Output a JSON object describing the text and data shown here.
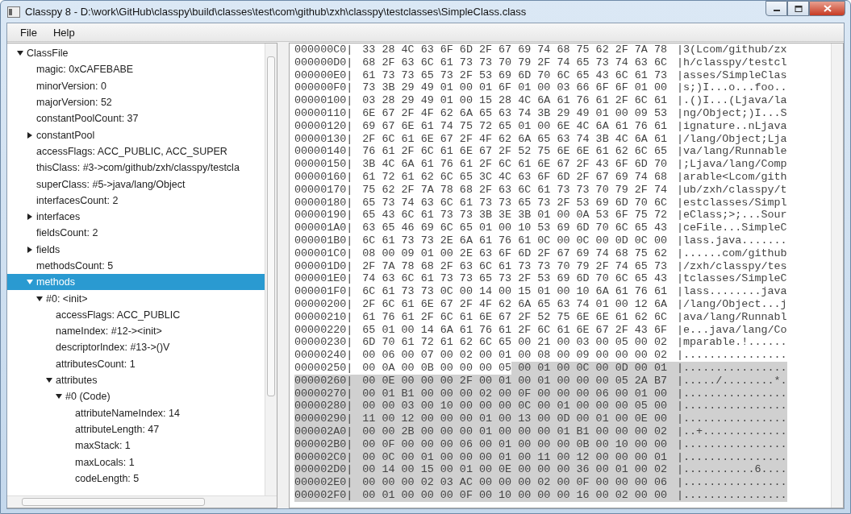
{
  "window": {
    "title": "Classpy 8 - D:\\work\\GitHub\\classpy\\build\\classes\\test\\com\\github\\zxh\\classpy\\testclasses\\SimpleClass.class"
  },
  "menu": [
    "File",
    "Help"
  ],
  "tree": [
    {
      "label": "ClassFile",
      "expanded": true,
      "selected": false,
      "children": [
        {
          "label": "magic: 0xCAFEBABE",
          "selected": false
        },
        {
          "label": "minorVersion: 0",
          "selected": false
        },
        {
          "label": "majorVersion: 52",
          "selected": false
        },
        {
          "label": "constantPoolCount: 37",
          "selected": false
        },
        {
          "label": "constantPool",
          "expanded": false,
          "selected": false
        },
        {
          "label": "accessFlags: ACC_PUBLIC, ACC_SUPER",
          "selected": false
        },
        {
          "label": "thisClass: #3->com/github/zxh/classpy/testcla",
          "selected": false
        },
        {
          "label": "superClass: #5->java/lang/Object",
          "selected": false
        },
        {
          "label": "interfacesCount: 2",
          "selected": false
        },
        {
          "label": "interfaces",
          "expanded": false,
          "selected": false
        },
        {
          "label": "fieldsCount: 2",
          "selected": false
        },
        {
          "label": "fields",
          "expanded": false,
          "selected": false
        },
        {
          "label": "methodsCount: 5",
          "selected": false
        },
        {
          "label": "methods",
          "expanded": true,
          "selected": true,
          "children": [
            {
              "label": "#0: <init>",
              "expanded": true,
              "selected": false,
              "children": [
                {
                  "label": "accessFlags: ACC_PUBLIC",
                  "selected": false
                },
                {
                  "label": "nameIndex: #12-><init>",
                  "selected": false
                },
                {
                  "label": "descriptorIndex: #13->()V",
                  "selected": false
                },
                {
                  "label": "attributesCount: 1",
                  "selected": false
                },
                {
                  "label": "attributes",
                  "expanded": true,
                  "selected": false,
                  "children": [
                    {
                      "label": "#0 (Code)",
                      "expanded": true,
                      "selected": false,
                      "children": [
                        {
                          "label": "attributeNameIndex: 14",
                          "selected": false
                        },
                        {
                          "label": "attributeLength: 47",
                          "selected": false
                        },
                        {
                          "label": "maxStack: 1",
                          "selected": false
                        },
                        {
                          "label": "maxLocals: 1",
                          "selected": false
                        },
                        {
                          "label": "codeLength: 5",
                          "selected": false
                        }
                      ]
                    }
                  ]
                }
              ]
            }
          ]
        }
      ]
    }
  ],
  "hex": [
    {
      "offset": "000000C0|",
      "bytes": "33 28 4C 63 6F 6D 2F 67 69 74 68 75 62 2F 7A 78",
      "ascii": "|3(Lcom/github/zx",
      "selected": false,
      "ascii_selected": false
    },
    {
      "offset": "000000D0|",
      "bytes": "68 2F 63 6C 61 73 73 70 79 2F 74 65 73 74 63 6C",
      "ascii": "|h/classpy/testcl",
      "selected": false,
      "ascii_selected": false
    },
    {
      "offset": "000000E0|",
      "bytes": "61 73 73 65 73 2F 53 69 6D 70 6C 65 43 6C 61 73",
      "ascii": "|asses/SimpleClas",
      "selected": false,
      "ascii_selected": false
    },
    {
      "offset": "000000F0|",
      "bytes": "73 3B 29 49 01 00 01 6F 01 00 03 66 6F 6F 01 00",
      "ascii": "|s;)I...o...foo..",
      "selected": false,
      "ascii_selected": false
    },
    {
      "offset": "00000100|",
      "bytes": "03 28 29 49 01 00 15 28 4C 6A 61 76 61 2F 6C 61",
      "ascii": "|.()I...(Ljava/la",
      "selected": false,
      "ascii_selected": false
    },
    {
      "offset": "00000110|",
      "bytes": "6E 67 2F 4F 62 6A 65 63 74 3B 29 49 01 00 09 53",
      "ascii": "|ng/Object;)I...S",
      "selected": false,
      "ascii_selected": false
    },
    {
      "offset": "00000120|",
      "bytes": "69 67 6E 61 74 75 72 65 01 00 6E 4C 6A 61 76 61",
      "ascii": "|ignature..nLjava",
      "selected": false,
      "ascii_selected": false
    },
    {
      "offset": "00000130|",
      "bytes": "2F 6C 61 6E 67 2F 4F 62 6A 65 63 74 3B 4C 6A 61",
      "ascii": "|/lang/Object;Lja",
      "selected": false,
      "ascii_selected": false
    },
    {
      "offset": "00000140|",
      "bytes": "76 61 2F 6C 61 6E 67 2F 52 75 6E 6E 61 62 6C 65",
      "ascii": "|va/lang/Runnable",
      "selected": false,
      "ascii_selected": false
    },
    {
      "offset": "00000150|",
      "bytes": "3B 4C 6A 61 76 61 2F 6C 61 6E 67 2F 43 6F 6D 70",
      "ascii": "|;Ljava/lang/Comp",
      "selected": false,
      "ascii_selected": false
    },
    {
      "offset": "00000160|",
      "bytes": "61 72 61 62 6C 65 3C 4C 63 6F 6D 2F 67 69 74 68",
      "ascii": "|arable<Lcom/gith",
      "selected": false,
      "ascii_selected": false
    },
    {
      "offset": "00000170|",
      "bytes": "75 62 2F 7A 78 68 2F 63 6C 61 73 73 70 79 2F 74",
      "ascii": "|ub/zxh/classpy/t",
      "selected": false,
      "ascii_selected": false
    },
    {
      "offset": "00000180|",
      "bytes": "65 73 74 63 6C 61 73 73 65 73 2F 53 69 6D 70 6C",
      "ascii": "|estclasses/Simpl",
      "selected": false,
      "ascii_selected": false
    },
    {
      "offset": "00000190|",
      "bytes": "65 43 6C 61 73 73 3B 3E 3B 01 00 0A 53 6F 75 72",
      "ascii": "|eClass;>;...Sour",
      "selected": false,
      "ascii_selected": false
    },
    {
      "offset": "000001A0|",
      "bytes": "63 65 46 69 6C 65 01 00 10 53 69 6D 70 6C 65 43",
      "ascii": "|ceFile...SimpleC",
      "selected": false,
      "ascii_selected": false
    },
    {
      "offset": "000001B0|",
      "bytes": "6C 61 73 73 2E 6A 61 76 61 0C 00 0C 00 0D 0C 00",
      "ascii": "|lass.java.......",
      "selected": false,
      "ascii_selected": false
    },
    {
      "offset": "000001C0|",
      "bytes": "08 00 09 01 00 2E 63 6F 6D 2F 67 69 74 68 75 62",
      "ascii": "|......com/github",
      "selected": false,
      "ascii_selected": false
    },
    {
      "offset": "000001D0|",
      "bytes": "2F 7A 78 68 2F 63 6C 61 73 73 70 79 2F 74 65 73",
      "ascii": "|/zxh/classpy/tes",
      "selected": false,
      "ascii_selected": false
    },
    {
      "offset": "000001E0|",
      "bytes": "74 63 6C 61 73 73 65 73 2F 53 69 6D 70 6C 65 43",
      "ascii": "|tclasses/SimpleC",
      "selected": false,
      "ascii_selected": false
    },
    {
      "offset": "000001F0|",
      "bytes": "6C 61 73 73 0C 00 14 00 15 01 00 10 6A 61 76 61",
      "ascii": "|lass........java",
      "selected": false,
      "ascii_selected": false
    },
    {
      "offset": "00000200|",
      "bytes": "2F 6C 61 6E 67 2F 4F 62 6A 65 63 74 01 00 12 6A",
      "ascii": "|/lang/Object...j",
      "selected": false,
      "ascii_selected": false
    },
    {
      "offset": "00000210|",
      "bytes": "61 76 61 2F 6C 61 6E 67 2F 52 75 6E 6E 61 62 6C",
      "ascii": "|ava/lang/Runnabl",
      "selected": false,
      "ascii_selected": false
    },
    {
      "offset": "00000220|",
      "bytes": "65 01 00 14 6A 61 76 61 2F 6C 61 6E 67 2F 43 6F",
      "ascii": "|e...java/lang/Co",
      "selected": false,
      "ascii_selected": false
    },
    {
      "offset": "00000230|",
      "bytes": "6D 70 61 72 61 62 6C 65 00 21 00 03 00 05 00 02",
      "ascii": "|mparable.!......",
      "selected": false,
      "ascii_selected": false
    },
    {
      "offset": "00000240|",
      "bytes": "00 06 00 07 00 02 00 01 00 08 00 09 00 00 00 02",
      "ascii": "|................",
      "selected": false,
      "ascii_selected": false
    },
    {
      "offset": "00000250|",
      "bytes": "00 0A 00 0B 00 00 00 05",
      "selected_bytes": "00 01 00 0C 00 0D 00 01",
      "ascii": "|................",
      "selected": false,
      "ascii_selected": true
    },
    {
      "offset": "00000260|",
      "bytes": "00 0E 00 00 00 2F 00 01 00 01 00 00 00 05 2A B7",
      "ascii": "|...../........*.",
      "selected": true,
      "ascii_selected": true
    },
    {
      "offset": "00000270|",
      "bytes": "00 01 B1 00 00 00 02 00 0F 00 00 00 06 00 01 00",
      "ascii": "|................",
      "selected": true,
      "ascii_selected": true
    },
    {
      "offset": "00000280|",
      "bytes": "00 00 03 00 10 00 00 00 0C 00 01 00 00 00 05 00",
      "ascii": "|................",
      "selected": true,
      "ascii_selected": true
    },
    {
      "offset": "00000290|",
      "bytes": "11 00 12 00 00 00 01 00 13 00 0D 00 01 00 0E 00",
      "ascii": "|................",
      "selected": true,
      "ascii_selected": true
    },
    {
      "offset": "000002A0|",
      "bytes": "00 00 2B 00 00 00 01 00 00 00 01 B1 00 00 00 02",
      "ascii": "|..+.............",
      "selected": true,
      "ascii_selected": true
    },
    {
      "offset": "000002B0|",
      "bytes": "00 0F 00 00 00 06 00 01 00 00 00 0B 00 10 00 00",
      "ascii": "|................",
      "selected": true,
      "ascii_selected": true
    },
    {
      "offset": "000002C0|",
      "bytes": "00 0C 00 01 00 00 00 01 00 11 00 12 00 00 00 01",
      "ascii": "|................",
      "selected": true,
      "ascii_selected": true
    },
    {
      "offset": "000002D0|",
      "bytes": "00 14 00 15 00 01 00 0E 00 00 00 36 00 01 00 02",
      "ascii": "|...........6....",
      "selected": true,
      "ascii_selected": true
    },
    {
      "offset": "000002E0|",
      "bytes": "00 00 00 02 03 AC 00 00 00 02 00 0F 00 00 00 06",
      "ascii": "|................",
      "selected": true,
      "ascii_selected": true
    },
    {
      "offset": "000002F0|",
      "bytes": "00 01 00 00 00 0F 00 10 00 00 00 16 00 02 00 00",
      "ascii": "|................",
      "selected": true,
      "ascii_selected": true
    }
  ]
}
